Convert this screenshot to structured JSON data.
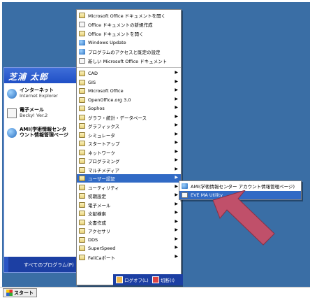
{
  "start_menu": {
    "user_name": "芝浦 太郎",
    "pinned": [
      {
        "title": "インターネット",
        "subtitle": "Internet Explorer",
        "icon": "internet-explorer-icon"
      },
      {
        "title": "電子メール",
        "subtitle": "Becky! Ver.2",
        "icon": "email-icon"
      },
      {
        "title": "AMI(学術情報センタ",
        "subtitle": "ウント情報管理ページ",
        "icon": "internet-explorer-icon"
      }
    ],
    "all_programs_label": "すべてのプログラム(P)"
  },
  "programs_menu": {
    "top_items": [
      {
        "label": "Microsoft Office ドキュメントを開く",
        "icon": "folder-open-icon"
      },
      {
        "label": "Office ドキュメントの新規作成",
        "icon": "document-new-icon"
      },
      {
        "label": "Office ドキュメントを開く",
        "icon": "folder-open-icon"
      },
      {
        "label": "Windows Update",
        "icon": "windows-update-icon"
      },
      {
        "label": "プログラムのアクセスと既定の設定",
        "icon": "program-defaults-icon"
      },
      {
        "label": "新しい Microsoft Office ドキュメント",
        "icon": "document-new-icon"
      }
    ],
    "folders": [
      {
        "label": "CAD"
      },
      {
        "label": "GIS"
      },
      {
        "label": "Microsoft Office"
      },
      {
        "label": "OpenOffice.org 3.0"
      },
      {
        "label": "Sophos"
      },
      {
        "label": "グラフ・統計・データベース"
      },
      {
        "label": "グラフィックス"
      },
      {
        "label": "シミュレータ"
      },
      {
        "label": "スタートアップ"
      },
      {
        "label": "ネットワーク"
      },
      {
        "label": "プログラミング"
      },
      {
        "label": "マルチメディア"
      },
      {
        "label": "ユーザー認証"
      },
      {
        "label": "ユーティリティ"
      },
      {
        "label": "初期設定"
      },
      {
        "label": "電子メール"
      },
      {
        "label": "文献検索"
      },
      {
        "label": "文書作成"
      },
      {
        "label": "アクセサリ"
      },
      {
        "label": "DDS"
      },
      {
        "label": "SuperSpeed"
      },
      {
        "label": "FeliCaポート"
      }
    ],
    "highlighted_folder": "ユーザー認証"
  },
  "auth_submenu": {
    "items": [
      {
        "label": "AMI(学術情報センター アカウント情報管理ページ)",
        "icon": "internet-explorer-icon"
      },
      {
        "label": "EVE MA Utility",
        "icon": "app-icon"
      }
    ],
    "highlighted_item": "EVE MA Utility"
  },
  "bottom_actions": {
    "logoff_label": "ログオフ(L)",
    "shutdown_label": "切断(I)"
  },
  "taskbar": {
    "start_label": "スタート"
  },
  "colors": {
    "desktop": "#3a6ea5",
    "highlight": "#316ac5",
    "annotation_arrow": "#c0506a"
  }
}
